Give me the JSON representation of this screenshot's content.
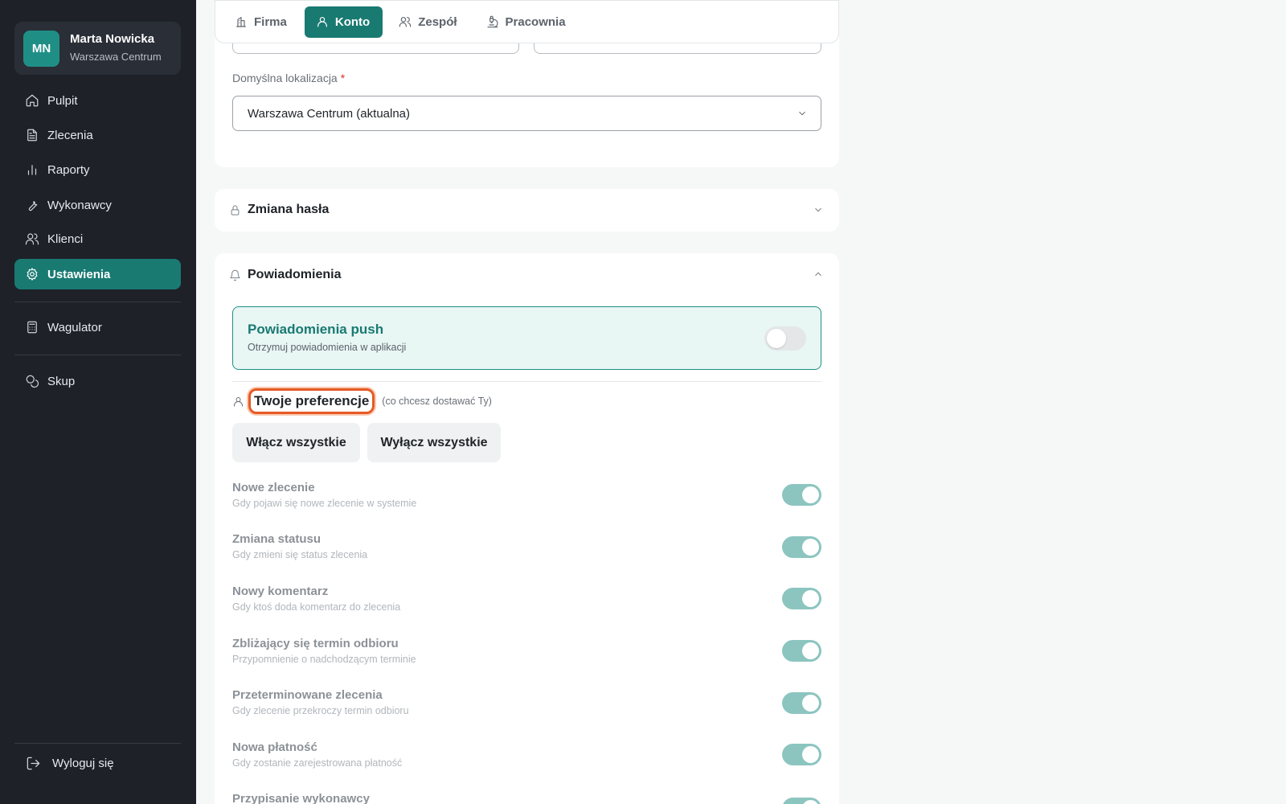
{
  "profile": {
    "initials": "MN",
    "name": "Marta Nowicka",
    "location": "Warszawa Centrum"
  },
  "sidebar": {
    "items": [
      {
        "label": "Pulpit",
        "icon": "home-icon"
      },
      {
        "label": "Zlecenia",
        "icon": "document-icon"
      },
      {
        "label": "Raporty",
        "icon": "bar-chart-icon"
      },
      {
        "label": "Wykonawcy",
        "icon": "wrench-icon"
      },
      {
        "label": "Klienci",
        "icon": "users-icon"
      },
      {
        "label": "Ustawienia",
        "icon": "gear-icon",
        "active": true
      },
      {
        "label": "Wagulator",
        "icon": "calculator-icon"
      },
      {
        "label": "Skup",
        "icon": "coins-icon"
      }
    ],
    "logout": "Wyloguj się"
  },
  "tabs": [
    {
      "label": "Firma",
      "icon": "building-icon"
    },
    {
      "label": "Konto",
      "icon": "user-icon",
      "active": true
    },
    {
      "label": "Zespół",
      "icon": "users-icon"
    },
    {
      "label": "Pracownia",
      "icon": "microscope-icon"
    }
  ],
  "account": {
    "location_label": "Domyślna lokalizacja",
    "required_mark": "*",
    "location_value": "Warszawa Centrum (aktualna)"
  },
  "password_section": {
    "title": "Zmiana hasła",
    "expanded": false
  },
  "notifications": {
    "title": "Powiadomienia",
    "expanded": true,
    "push": {
      "title": "Powiadomienia push",
      "subtitle": "Otrzymuj powiadomienia w aplikacji",
      "enabled": false
    },
    "preferences_title": "Twoje preferencje",
    "preferences_hint": "(co chcesz dostawać Ty)",
    "enable_all": "Włącz wszystkie",
    "disable_all": "Wyłącz wszystkie",
    "items": [
      {
        "title": "Nowe zlecenie",
        "desc": "Gdy pojawi się nowe zlecenie w systemie",
        "enabled": true
      },
      {
        "title": "Zmiana statusu",
        "desc": "Gdy zmieni się status zlecenia",
        "enabled": true
      },
      {
        "title": "Nowy komentarz",
        "desc": "Gdy ktoś doda komentarz do zlecenia",
        "enabled": true
      },
      {
        "title": "Zbliżający się termin odbioru",
        "desc": "Przypomnienie o nadchodzącym terminie",
        "enabled": true
      },
      {
        "title": "Przeterminowane zlecenia",
        "desc": "Gdy zlecenie przekroczy termin odbioru",
        "enabled": true
      },
      {
        "title": "Nowa płatność",
        "desc": "Gdy zostanie zarejestrowana płatność",
        "enabled": true
      },
      {
        "title": "Przypisanie wykonawcy",
        "desc": "",
        "enabled": true
      }
    ]
  },
  "colors": {
    "accent": "#197a72",
    "sidebar_bg": "#1e2128",
    "highlight": "#e55a25"
  }
}
